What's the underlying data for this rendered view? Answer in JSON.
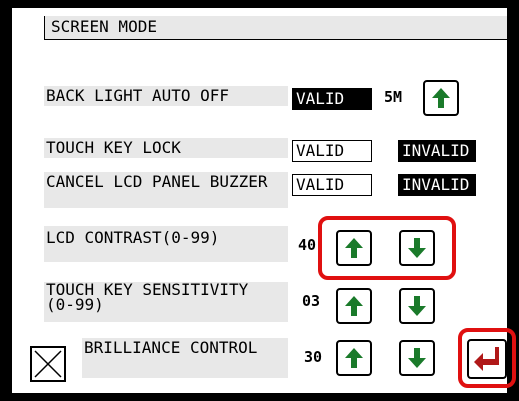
{
  "screen_title": "SCREEN MODE",
  "settings": {
    "back_light": {
      "label": "BACK LIGHT AUTO OFF",
      "value": "VALID",
      "time": "5M"
    },
    "touch_key_lock": {
      "label": "TOUCH KEY LOCK",
      "valid": "VALID",
      "invalid": "INVALID"
    },
    "cancel_buzzer": {
      "label": "CANCEL LCD PANEL BUZZER",
      "valid": "VALID",
      "invalid": "INVALID"
    },
    "lcd_contrast": {
      "label": "LCD CONTRAST(0-99)",
      "value": "40"
    },
    "touch_sensitivity": {
      "label_line1": "TOUCH KEY SENSITIVITY",
      "label_line2": "(0-99)",
      "value": "03"
    },
    "brilliance": {
      "label": "BRILLIANCE CONTROL",
      "value": "30"
    }
  },
  "colors": {
    "highlight": "#e01010",
    "enter_arrow": "#b01818",
    "up_down_arrow": "#1a7a2a"
  },
  "icons": {
    "up": "arrow-up-icon",
    "down": "arrow-down-icon",
    "cancel": "close-icon",
    "enter": "enter-icon"
  }
}
